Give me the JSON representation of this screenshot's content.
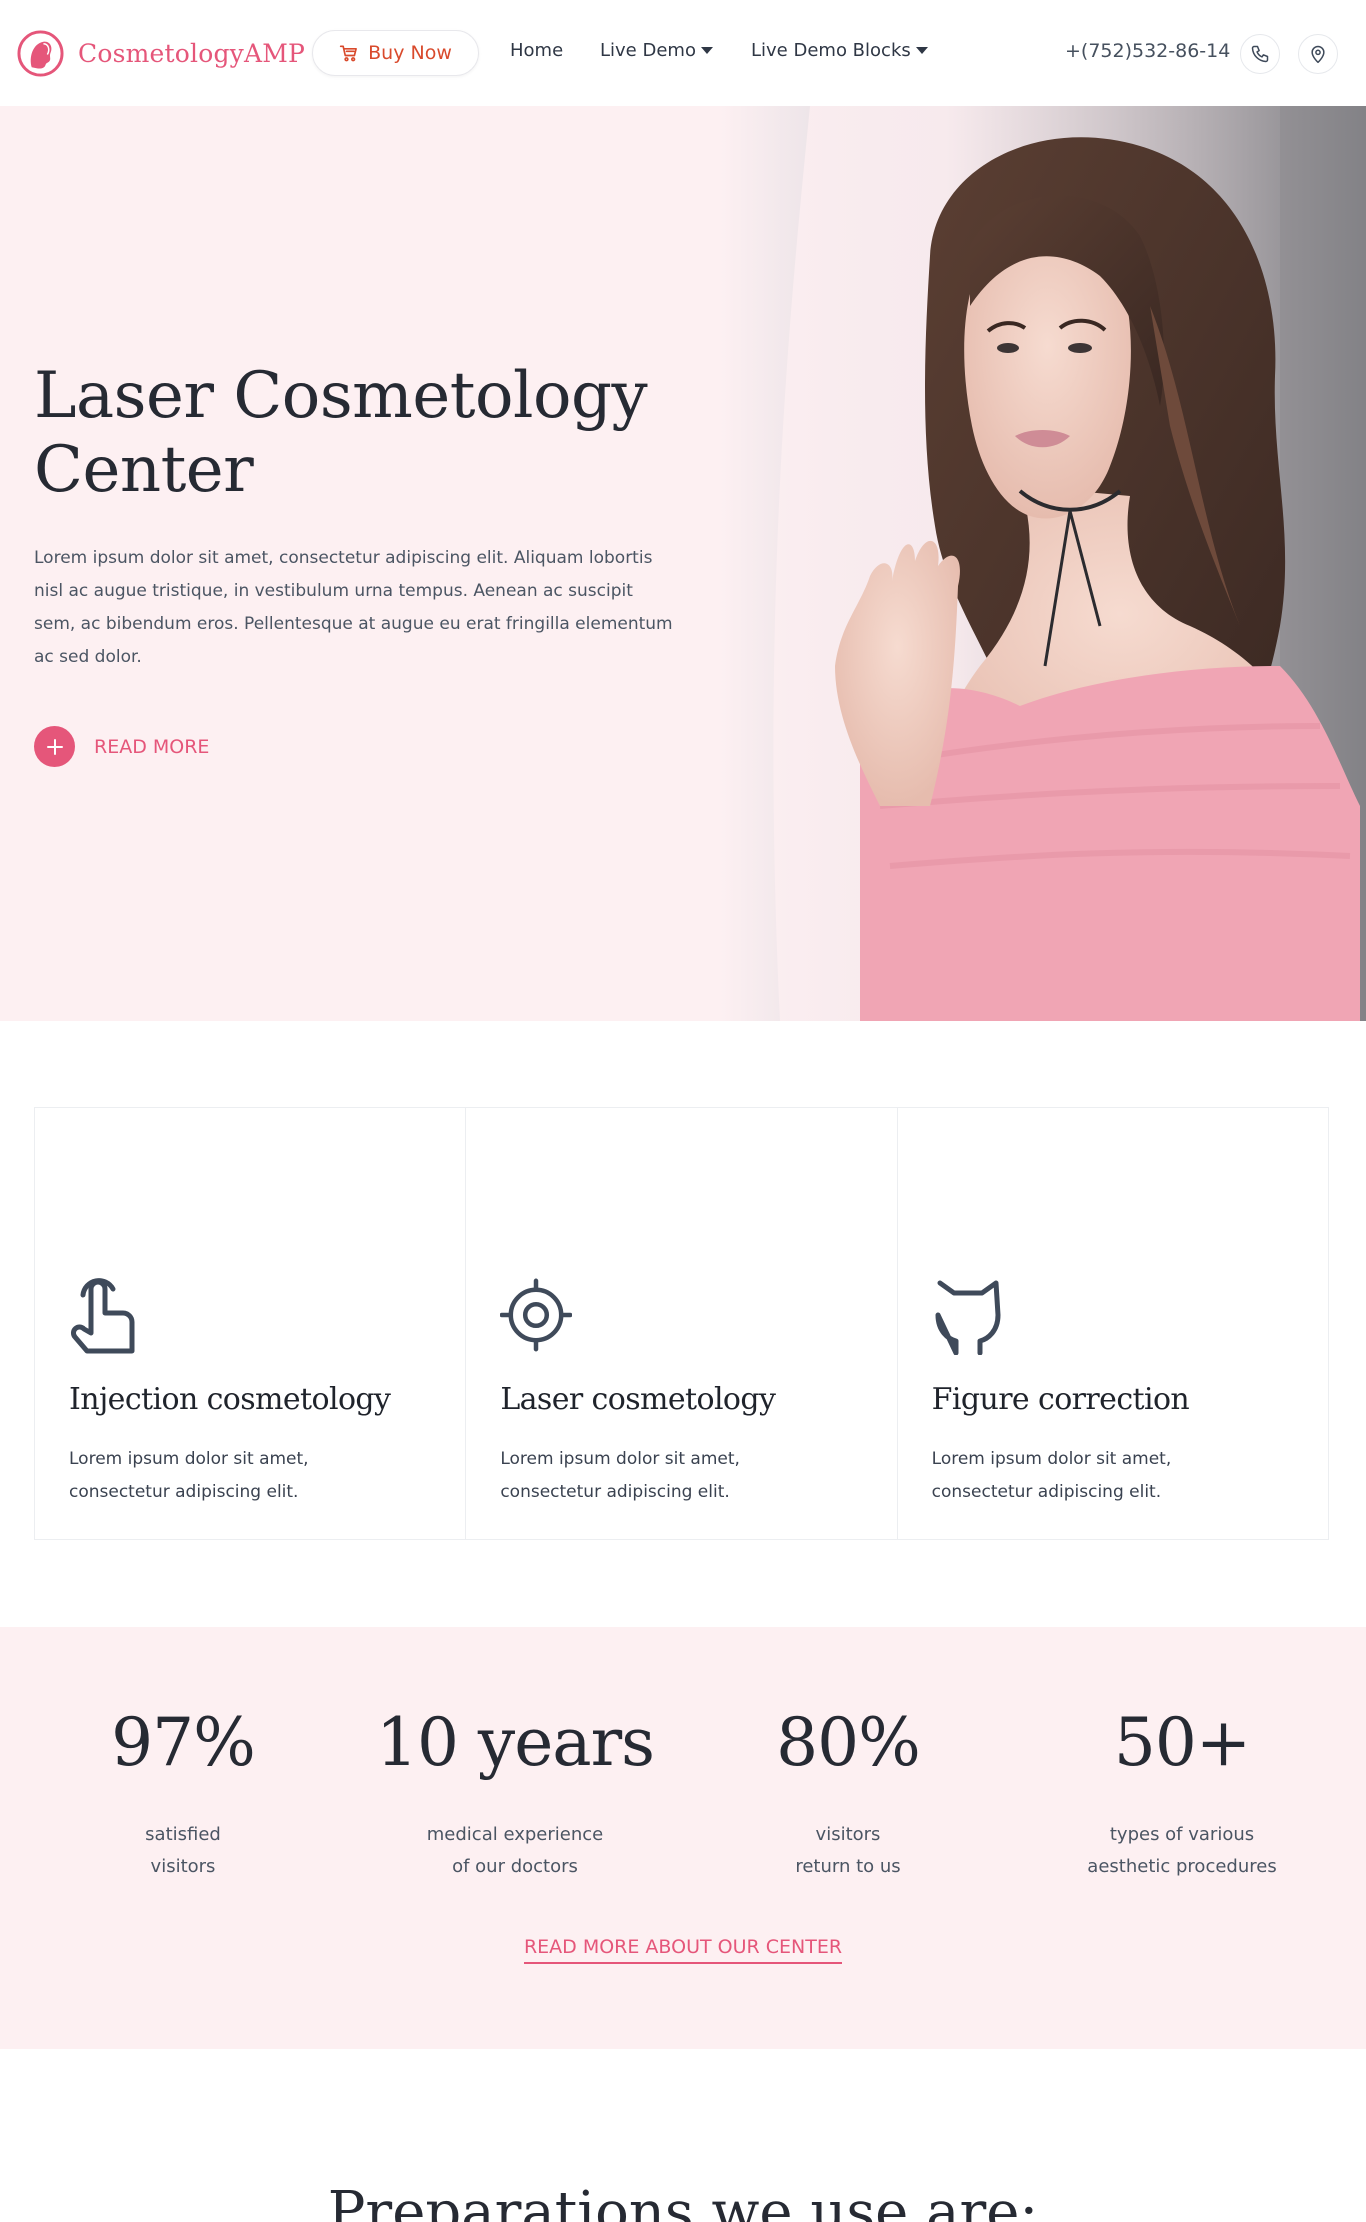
{
  "header": {
    "logo_text": "CosmetologyAMP",
    "buy_label": "Buy Now",
    "nav": [
      {
        "label": "Home"
      },
      {
        "label": "Live Demo"
      },
      {
        "label": "Live Demo Blocks"
      }
    ],
    "phone": "+(752)532-86-14"
  },
  "hero": {
    "title": "Laser Cosmetology Center",
    "text": "Lorem ipsum dolor sit amet, consectetur adipiscing elit. Aliquam lobortis nisl ac augue tristique, in vestibulum urna tempus. Aenean ac suscipit sem, ac bibendum eros. Pellentesque at augue eu erat fringilla elementum ac sed dolor.",
    "read_more": "READ MORE"
  },
  "services": [
    {
      "icon": "hand-pointer-icon",
      "title": "Injection cosmetology",
      "desc": "Lorem ipsum dolor sit amet, consectetur adipiscing elit."
    },
    {
      "icon": "target-icon",
      "title": "Laser cosmetology",
      "desc": "Lorem ipsum dolor sit amet, consectetur adipiscing elit."
    },
    {
      "icon": "cat-face-icon",
      "title": "Figure correction",
      "desc": "Lorem ipsum dolor sit amet, consectetur adipiscing elit."
    }
  ],
  "stats": [
    {
      "value": "97%",
      "label": "satisfied\nvisitors"
    },
    {
      "value": "10 years",
      "label": "medical experience\nof our doctors"
    },
    {
      "value": "80%",
      "label": "visitors\nreturn to us"
    },
    {
      "value": "50+",
      "label": "types of various\naesthetic procedures"
    }
  ],
  "stats_link": "READ MORE ABOUT OUR CENTER",
  "preparations_title": "Preparations we use are:",
  "colors": {
    "accent": "#e5567a",
    "hero_bg": "#fdf0f2",
    "dark_text": "#262a33",
    "icon_color": "#3f4a5a"
  }
}
